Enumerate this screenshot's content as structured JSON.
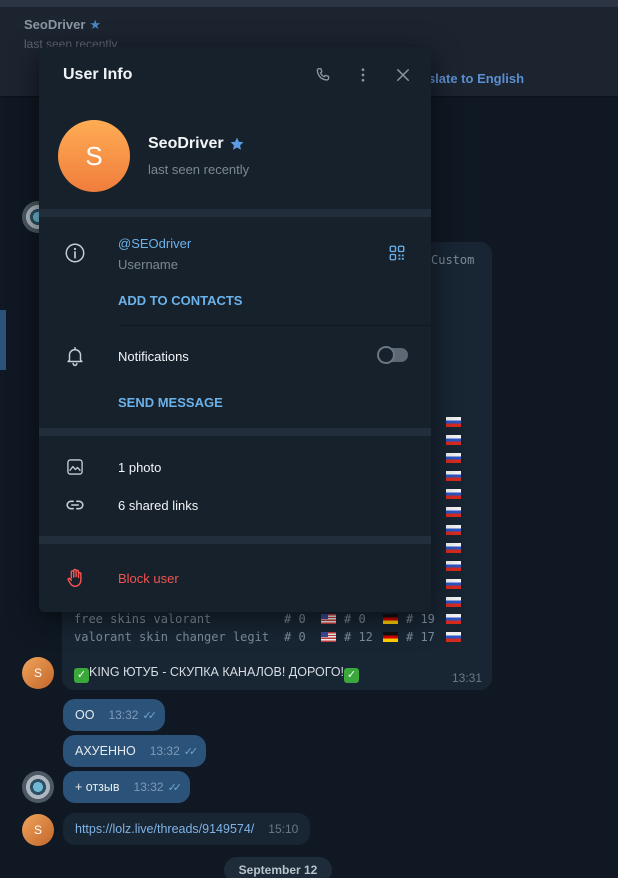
{
  "chat": {
    "header_name": "SeoDriver",
    "header_status": "last seen recently",
    "translate_label": "nslate to English",
    "partial_text": "Custom",
    "rows": [
      {
        "label": "free skins valorant",
        "c1": "# 0",
        "c2": "# 0",
        "c3": "# 19"
      },
      {
        "label": "valorant skin changer legit",
        "c1": "# 0",
        "c2": "# 12",
        "c3": "# 17"
      }
    ],
    "promo_text": "KING ЮТУБ - СКУПКА КАНАЛОВ! ДОРОГО!",
    "promo_time": "13:31",
    "messages": [
      {
        "text": "ОО",
        "time": "13:32"
      },
      {
        "text": "АХУЕННО",
        "time": "13:32"
      },
      {
        "text": "+ отзыв",
        "time": "13:32"
      },
      {
        "text": "https://lolz.live/threads/9149574/",
        "time": "15:10"
      }
    ],
    "date_pill": "September 12",
    "avatar_letter": "S"
  },
  "modal": {
    "title": "User Info",
    "icons": {
      "call": "phone-icon",
      "more": "more-vertical-icon",
      "close": "close-icon"
    },
    "profile": {
      "avatar_letter": "S",
      "name": "SeoDriver",
      "status": "last seen recently",
      "badge": "star-icon"
    },
    "info": {
      "username": "@SEOdriver",
      "username_label": "Username",
      "add_contacts": "ADD TO CONTACTS"
    },
    "notifications": {
      "label": "Notifications",
      "enabled": false,
      "send_message": "SEND MESSAGE"
    },
    "media": {
      "photos": "1 photo",
      "links": "6 shared links"
    },
    "block": {
      "label": "Block user"
    }
  },
  "colors": {
    "accent": "#6cb2ea",
    "danger": "#f05350",
    "modal_bg": "#17212b",
    "avatar_orange": "#f7934a"
  }
}
